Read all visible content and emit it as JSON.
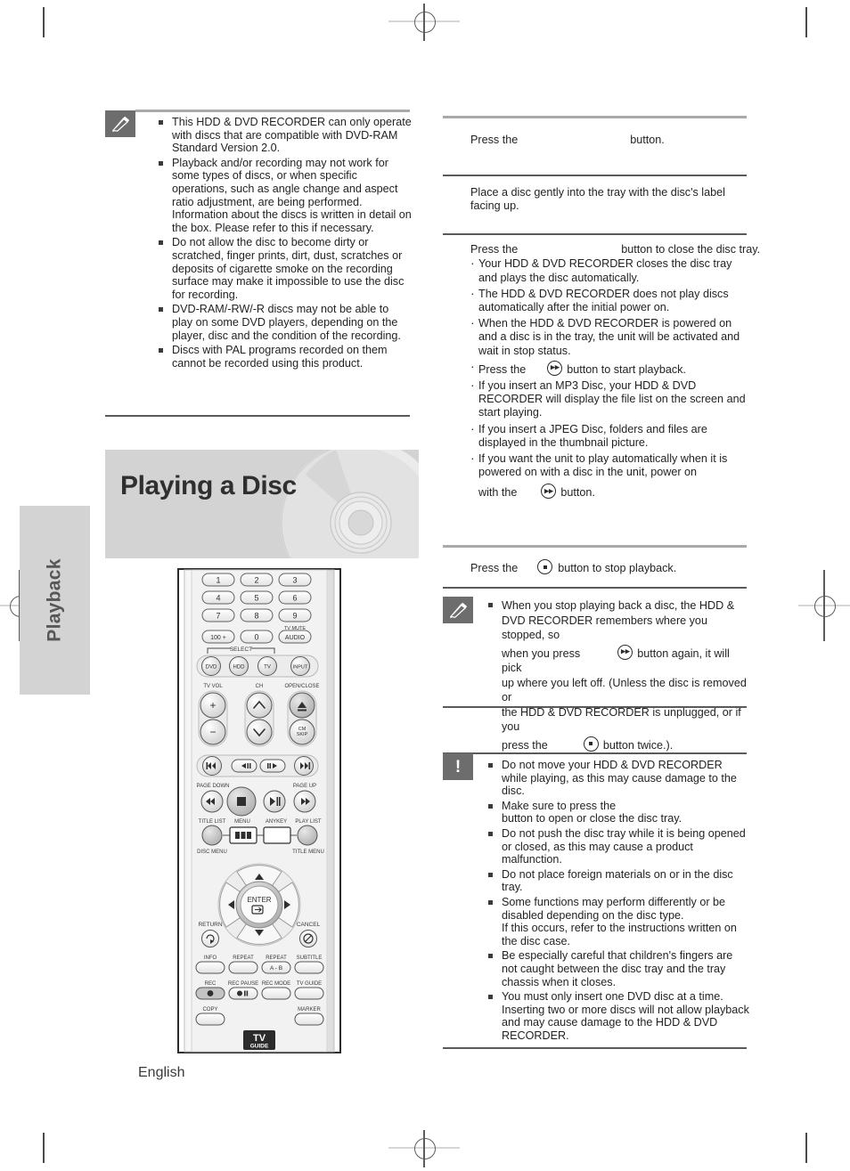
{
  "page": {
    "chapter_tab": "Playback",
    "title": "Playing a Disc",
    "footer_language": "English"
  },
  "note_left": {
    "icon": "pencil-note-icon",
    "items": [
      "This HDD & DVD RECORDER can only operate with discs that are compatible with DVD-RAM Standard Version 2.0.",
      "Playback and/or recording may not work for some types of discs, or when specific operations, such as angle change and aspect ratio adjustment, are being performed. Information about the discs is written in detail on the box. Please refer to this if necessary.",
      "Do not allow the disc to become dirty or scratched, finger prints, dirt, dust, scratches or deposits of cigarette smoke on the recording surface may make it impossible to use the disc for recording.",
      "DVD-RAM/-RW/-R discs may not be able to play on some DVD players, depending on the player, disc and the condition of the recording.",
      "Discs with PAL programs recorded on them cannot be recorded using this product."
    ]
  },
  "steps": [
    {
      "id": "step-1",
      "line_before": "Press the",
      "line_after": "button."
    },
    {
      "id": "step-2",
      "text": "Place a disc gently into the tray with the disc's label facing up."
    },
    {
      "id": "step-3",
      "line_before": "Press the",
      "line_after": "button to close the disc tray.",
      "bullets": [
        "Your HDD & DVD RECORDER closes the disc tray and plays the disc automatically.",
        "The HDD & DVD RECORDER does not play discs automatically after the initial power on.",
        "When the HDD & DVD RECORDER is powered on and a disc is in the tray, the unit will be activated and wait in stop status."
      ],
      "bullets_with_icon": [
        {
          "before": "Press the",
          "icon": "play-button-icon",
          "after": "button to start playback."
        }
      ],
      "bullets_tail": [
        "If you insert an MP3 Disc, your HDD & DVD RECORDER will display the file list on the screen and start playing.",
        "If you insert a JPEG Disc, folders and files are displayed in the thumbnail picture."
      ],
      "bullet_last": {
        "text": "If you want the unit to play automatically when it is powered on with a disc in the unit, power on",
        "before": "with the",
        "icon": "play-button-icon",
        "after": "button."
      }
    },
    {
      "id": "step-4",
      "line_before": "Press the",
      "icon": "stop-button-icon",
      "line_after": "button to stop playback."
    }
  ],
  "note_right": {
    "icon": "pencil-note-icon",
    "parts": {
      "p1": "When you stop playing back a disc, the HDD & DVD RECORDER remembers where you stopped, so",
      "p2_before": "when you press",
      "p2_icon": "play-button-icon",
      "p2_after": "button again, it will pick",
      "p3": "up where you left off. (Unless the disc is removed or",
      "p4": "the HDD & DVD RECORDER is unplugged, or if you",
      "p5_before": "press the",
      "p5_icon": "stop-button-icon",
      "p5_after": "button twice.)."
    }
  },
  "caution": {
    "icon": "exclamation-icon",
    "glyph": "!",
    "items": [
      "Do not move your HDD & DVD RECORDER while playing, as this may cause damage to the disc.",
      "Make sure to press the\nbutton to open or close the disc tray.",
      "Do not push the disc tray while it is being opened or closed, as this may cause a product malfunction.",
      "Do not place foreign materials on or in the disc tray.",
      "Some functions may perform differently or be disabled depending on the disc type.\nIf this occurs, refer to the instructions written on the disc case.",
      "Be especially careful that children's fingers are not caught between the disc tray and the tray chassis when it closes.",
      "You must only insert one DVD disc at a time. Inserting two or more discs will not allow playback and may cause damage to the HDD & DVD RECORDER."
    ]
  },
  "remote": {
    "name": "remote-control-illustration",
    "numeric_keys": [
      "1",
      "2",
      "3",
      "4",
      "5",
      "6",
      "7",
      "8",
      "9",
      "100 +",
      "0"
    ],
    "audio_key": {
      "label_top": "TV MUTE",
      "label": "AUDIO"
    },
    "select_label": "SELECT",
    "select_keys": [
      "DVD",
      "HDD",
      "TV",
      "INPUT"
    ],
    "group_labels": {
      "tv_vol": "TV VOL",
      "ch": "CH",
      "open_close": "OPEN/CLOSE"
    },
    "tv_vol_keys": [
      "+",
      "−"
    ],
    "ch_keys": [
      "⌃",
      "⌄"
    ],
    "cm_skip": {
      "line1": "CM",
      "line2": "SKIP"
    },
    "transport_row1": [
      "⏮",
      "⏪❘",
      "❘⏩",
      "⏭"
    ],
    "page_labels": {
      "down": "PAGE DOWN",
      "up": "PAGE UP"
    },
    "transport_row2": [
      "◀◀",
      "■",
      "▶❘❘",
      "▶▶"
    ],
    "menu_row": {
      "title_list": "TITLE LIST",
      "menu": "MENU",
      "anykey": "ANYKEY",
      "play_list": "PLAY LIST",
      "disc_menu": "DISC MENU",
      "title_menu": "TITLE MENU"
    },
    "dpad": {
      "enter": "ENTER",
      "return": "RETURN",
      "cancel": "CANCEL"
    },
    "function_row1": [
      "INFO",
      "REPEAT",
      "REPEAT",
      "SUBTITLE"
    ],
    "repeat_ab": "A - B",
    "function_row2": [
      "REC",
      "REC PAUSE",
      "REC MODE",
      "TV GUIDE"
    ],
    "function_row3": [
      "COPY",
      "MARKER"
    ],
    "logo": {
      "line1": "TV",
      "line2": "GUIDE"
    }
  },
  "colors": {
    "banner_gray": "#d3d3d3",
    "badge_gray": "#6d6d6d",
    "rule_gray": "#a9a9a9",
    "text": "#231f20"
  }
}
